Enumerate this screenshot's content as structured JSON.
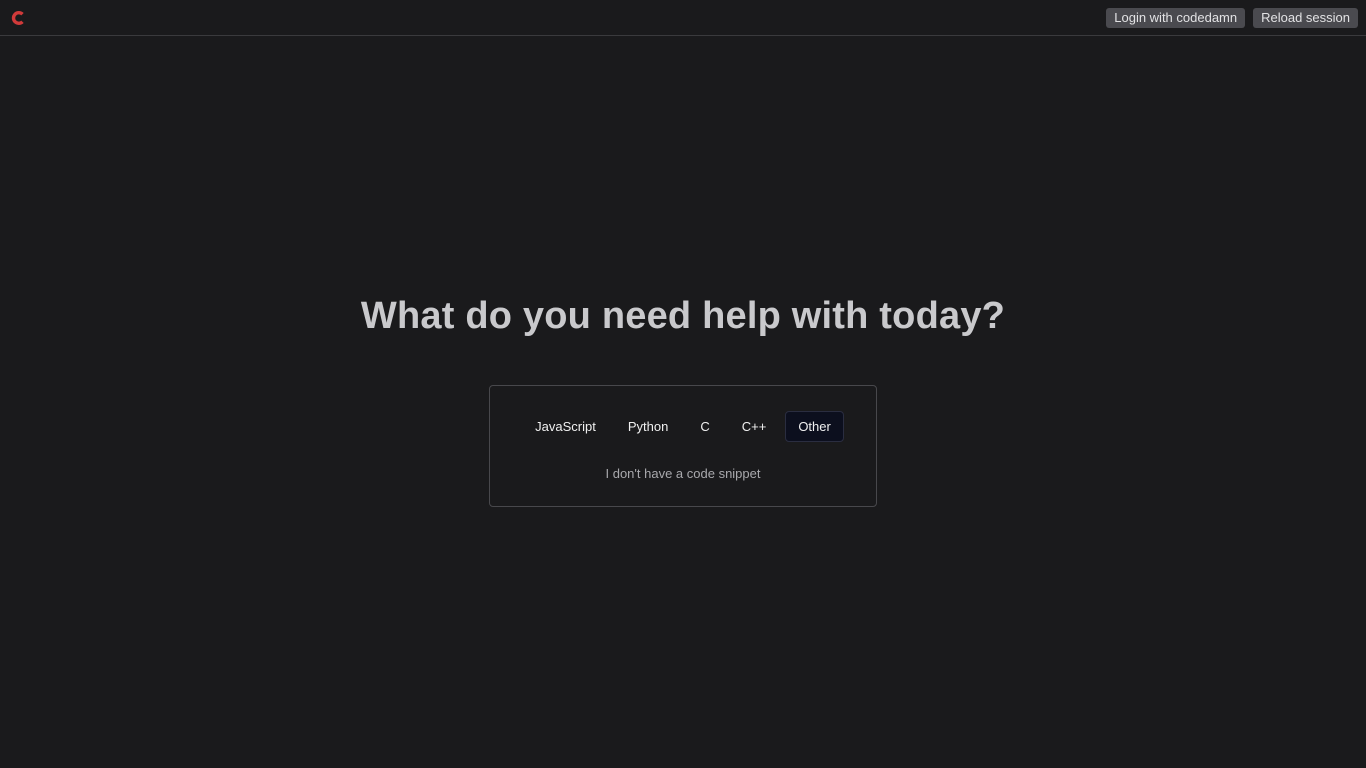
{
  "header": {
    "logo_icon": "codedamn-logo-icon",
    "logo_color": "#d03a3a",
    "login_label": "Login with codedamn",
    "reload_label": "Reload session"
  },
  "main": {
    "headline": "What do you need help with today?",
    "languages": [
      {
        "label": "JavaScript",
        "selected": false
      },
      {
        "label": "Python",
        "selected": false
      },
      {
        "label": "C",
        "selected": false
      },
      {
        "label": "C++",
        "selected": false
      },
      {
        "label": "Other",
        "selected": true
      }
    ],
    "no_snippet_label": "I don't have a code snippet"
  }
}
